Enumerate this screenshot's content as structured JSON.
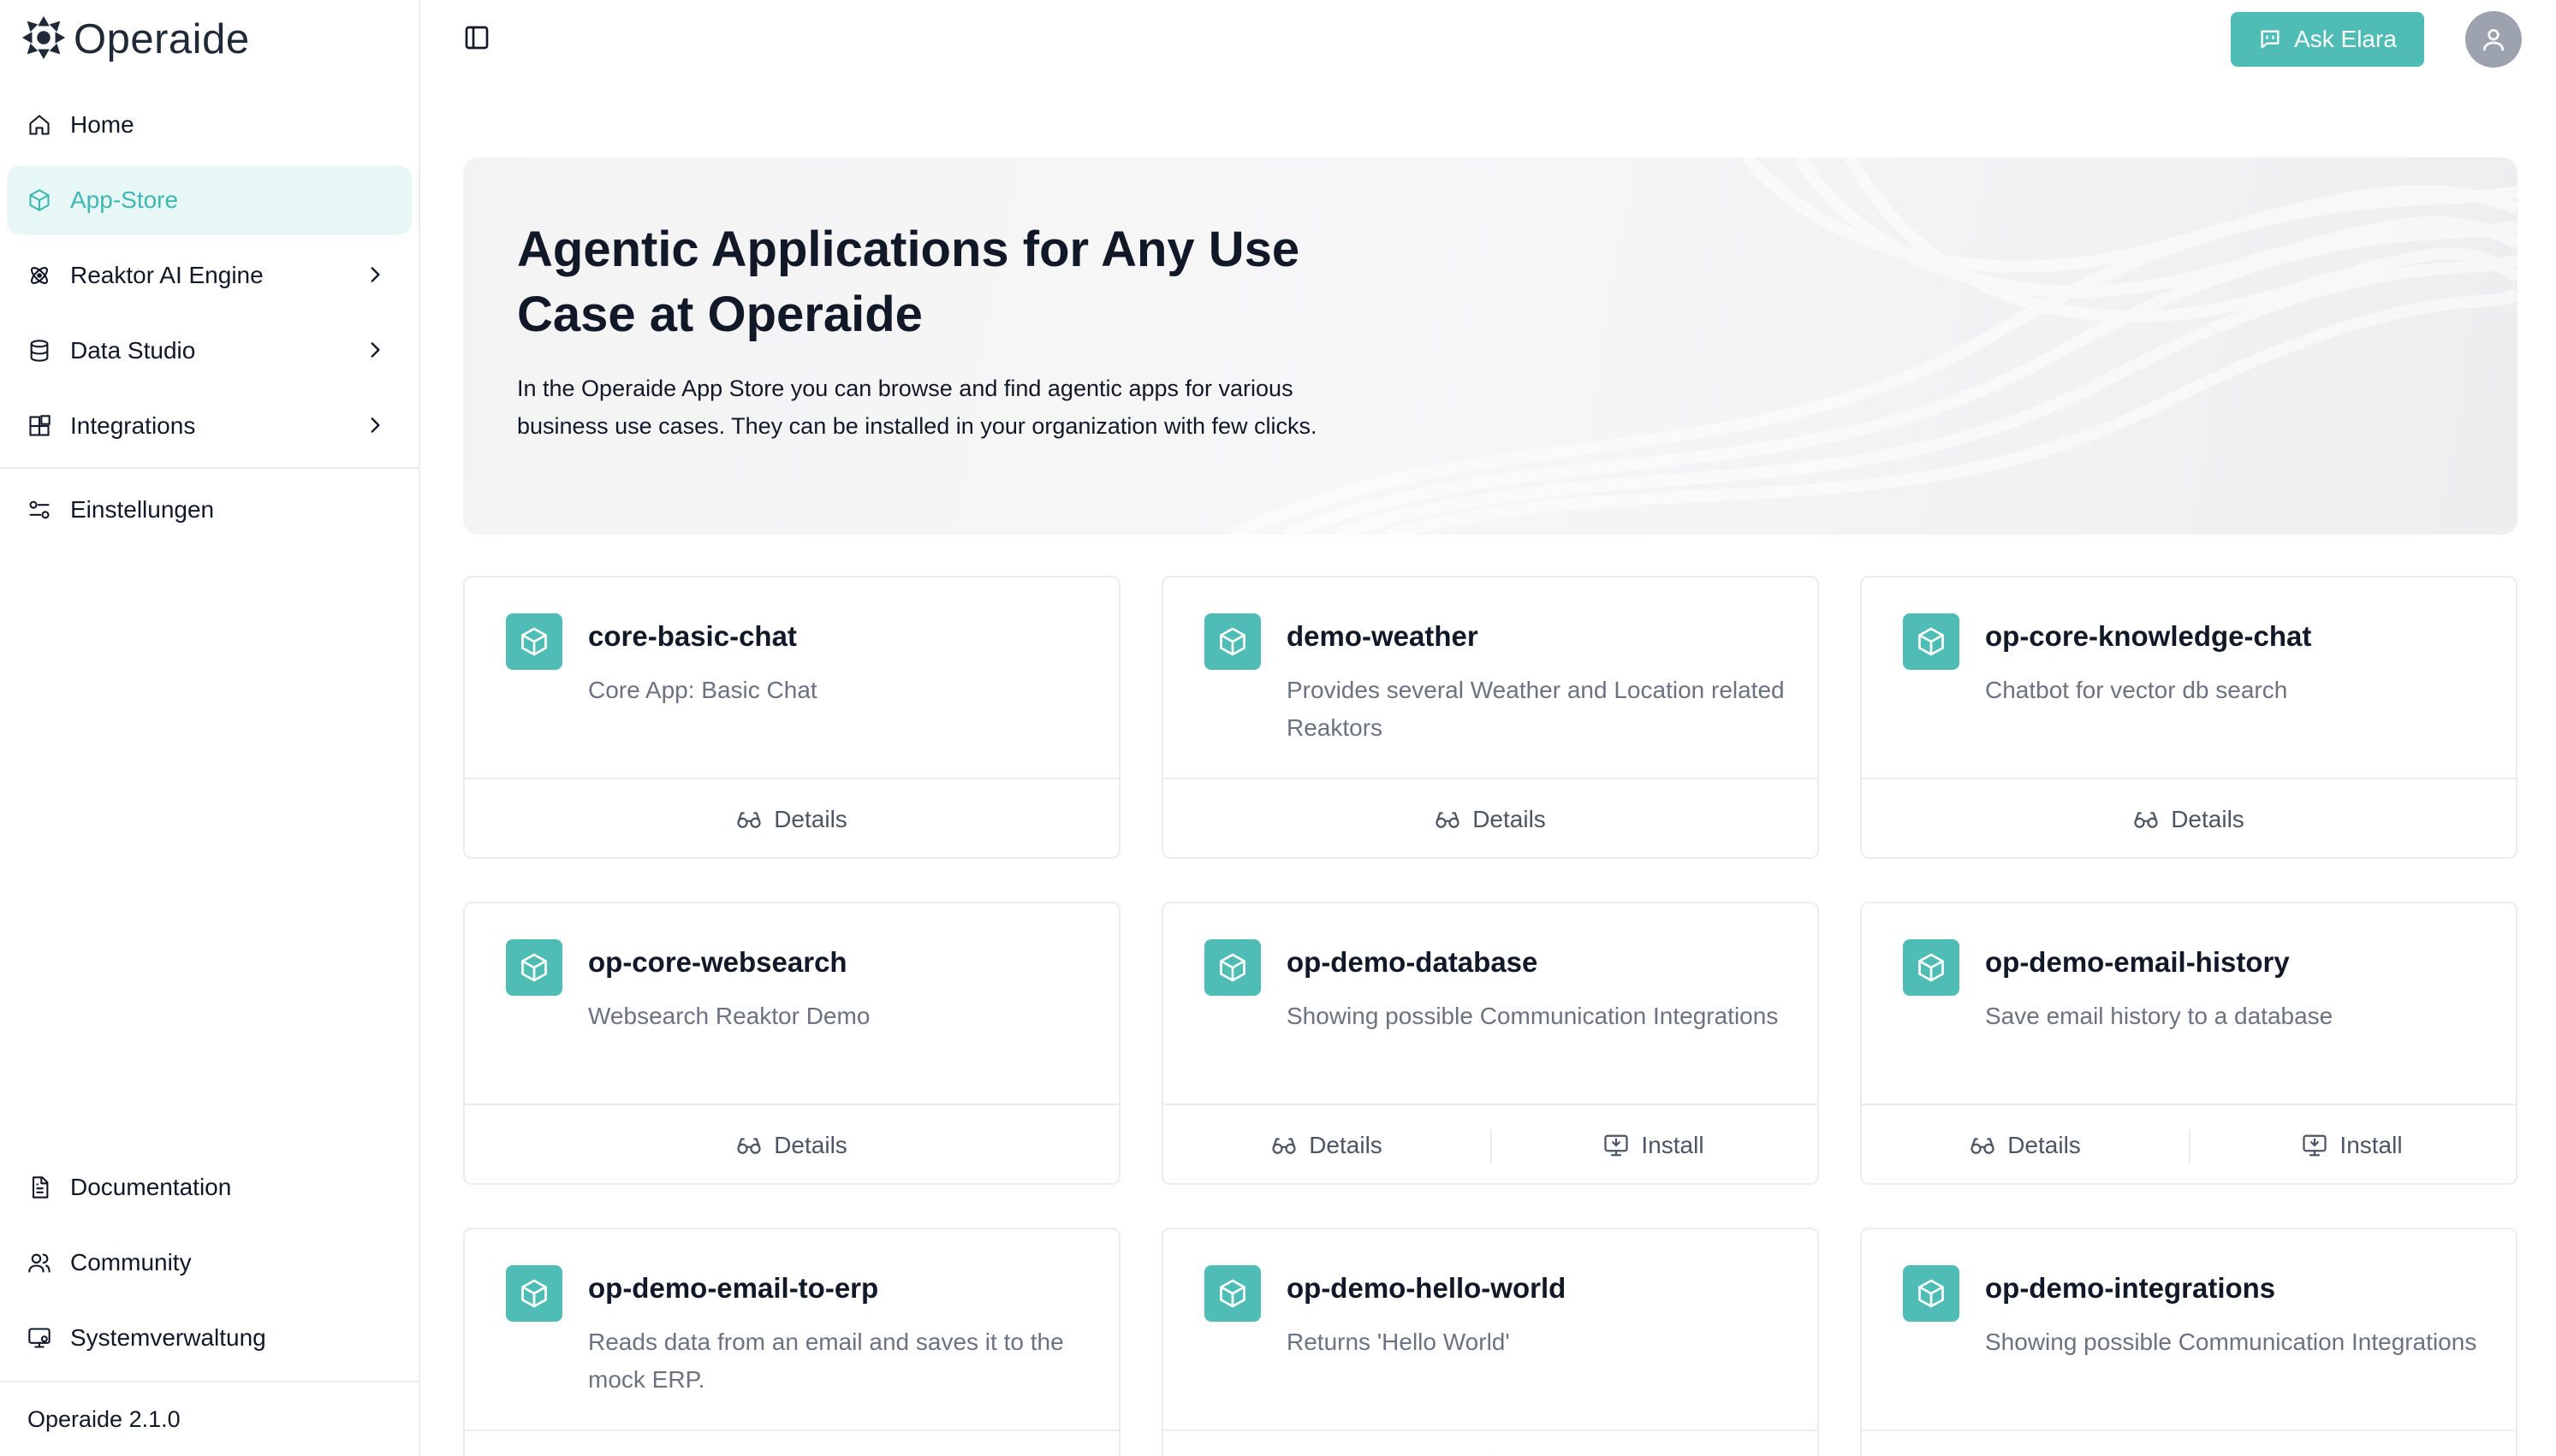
{
  "brand": {
    "name": "Operaide",
    "logo_icon": "operaide-logo-icon"
  },
  "sidebar": {
    "items": [
      {
        "label": "Home",
        "icon": "home-icon"
      },
      {
        "label": "App-Store",
        "icon": "box-icon",
        "active": true
      },
      {
        "label": "Reaktor AI Engine",
        "icon": "atom-icon",
        "has_submenu": true
      },
      {
        "label": "Data Studio",
        "icon": "database-icon",
        "has_submenu": true
      },
      {
        "label": "Integrations",
        "icon": "blocks-icon",
        "has_submenu": true
      },
      {
        "label": "Einstellungen",
        "icon": "settings-sliders-icon"
      }
    ],
    "bottom_items": [
      {
        "label": "Documentation",
        "icon": "document-icon"
      },
      {
        "label": "Community",
        "icon": "users-icon"
      },
      {
        "label": "Systemverwaltung",
        "icon": "monitor-cog-icon"
      }
    ],
    "version": "Operaide 2.1.0"
  },
  "topbar": {
    "ask_label": "Ask Elara",
    "ask_icon": "bot-message-icon",
    "toggle_icon": "sidebar-toggle-icon",
    "avatar_icon": "user-icon"
  },
  "hero": {
    "title": "Agentic Applications for Any Use Case at Operaide",
    "description": "In the Operaide App Store you can browse and find agentic apps for various business use cases. They can be installed in your organization with few clicks."
  },
  "actions": {
    "details": "Details",
    "install": "Install"
  },
  "apps": [
    {
      "title": "core-basic-chat",
      "description": "Core App: Basic Chat",
      "installable": false
    },
    {
      "title": "demo-weather",
      "description": "Provides several Weather and Location related Reaktors",
      "installable": false
    },
    {
      "title": "op-core-knowledge-chat",
      "description": "Chatbot for vector db search",
      "installable": false
    },
    {
      "title": "op-core-websearch",
      "description": "Websearch Reaktor Demo",
      "installable": false
    },
    {
      "title": "op-demo-database",
      "description": "Showing possible Communication Integrations",
      "installable": true
    },
    {
      "title": "op-demo-email-history",
      "description": "Save email history to a database",
      "installable": true
    },
    {
      "title": "op-demo-email-to-erp",
      "description": "Reads data from an email and saves it to the mock ERP.",
      "installable": false
    },
    {
      "title": "op-demo-hello-world",
      "description": "Returns 'Hello World'",
      "installable": true
    },
    {
      "title": "op-demo-integrations",
      "description": "Showing possible Communication Integrations",
      "installable": false
    }
  ],
  "colors": {
    "accent": "#4fbdb6",
    "active_bg": "#e7f7f6",
    "active_text": "#3fb8b3"
  }
}
